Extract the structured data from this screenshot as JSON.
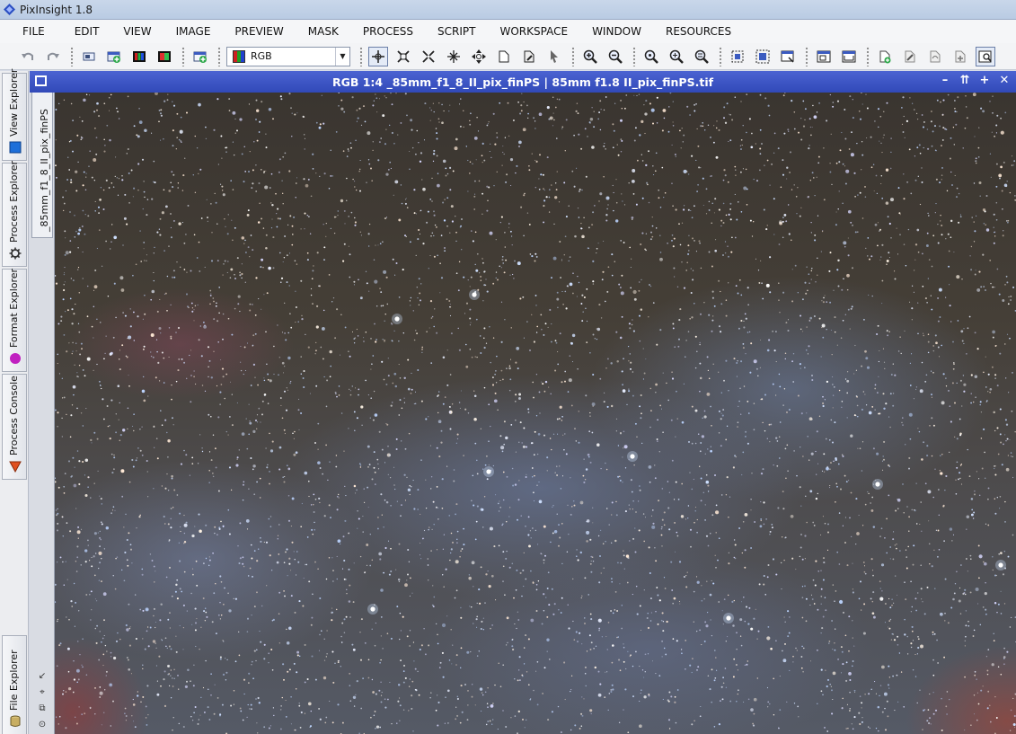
{
  "app": {
    "title": "PixInsight 1.8",
    "accent": "#3f57c8"
  },
  "menu": {
    "items": [
      "FILE",
      "EDIT",
      "VIEW",
      "IMAGE",
      "PREVIEW",
      "MASK",
      "PROCESS",
      "SCRIPT",
      "WORKSPACE",
      "WINDOW",
      "RESOURCES"
    ]
  },
  "toolbar": {
    "view_selector_value": "RGB",
    "icons": [
      "undo-icon",
      "redo-icon",
      "new-image-icon",
      "new-image-window-icon",
      "rgb-channels-icon",
      "channel-toggle-icon",
      "new-preview-icon",
      "pan-mode-icon",
      "zoom-fit-icon",
      "contract-icon",
      "expand-icon",
      "move-icon",
      "page-icon",
      "page-edit-icon",
      "pointer-icon",
      "zoom-in-icon",
      "zoom-out-icon",
      "zoom-1-icon",
      "zoom-2-icon",
      "zoom-3-icon",
      "select-icon",
      "select-multi-icon",
      "crop-icon",
      "fit-window-icon",
      "fullscreen-icon",
      "new-instance-icon",
      "edit-instance-icon",
      "reset-icon",
      "add-icon",
      "search-window-icon"
    ]
  },
  "sidebar": {
    "tabs": [
      {
        "label": "View Explorer",
        "icon": "view-explorer-icon",
        "color": "#1e6fd9"
      },
      {
        "label": "Process Explorer",
        "icon": "gear-icon",
        "color": "#333333"
      },
      {
        "label": "Format Explorer",
        "icon": "format-explorer-icon",
        "color": "#c020c0"
      },
      {
        "label": "Process Console",
        "icon": "process-console-icon",
        "color": "#e05020"
      },
      {
        "label": "File Explorer",
        "icon": "file-explorer-icon",
        "color": "#b8a060"
      }
    ]
  },
  "image_window": {
    "title": "RGB 1:4 _85mm_f1_8_II_pix_finPS | 85mm f1.8 II_pix_finPS.tif",
    "doc_tab": "_85mm_f1_8_II_pix_finPS",
    "controls": [
      "–",
      "⇈",
      "+",
      "✕"
    ]
  }
}
